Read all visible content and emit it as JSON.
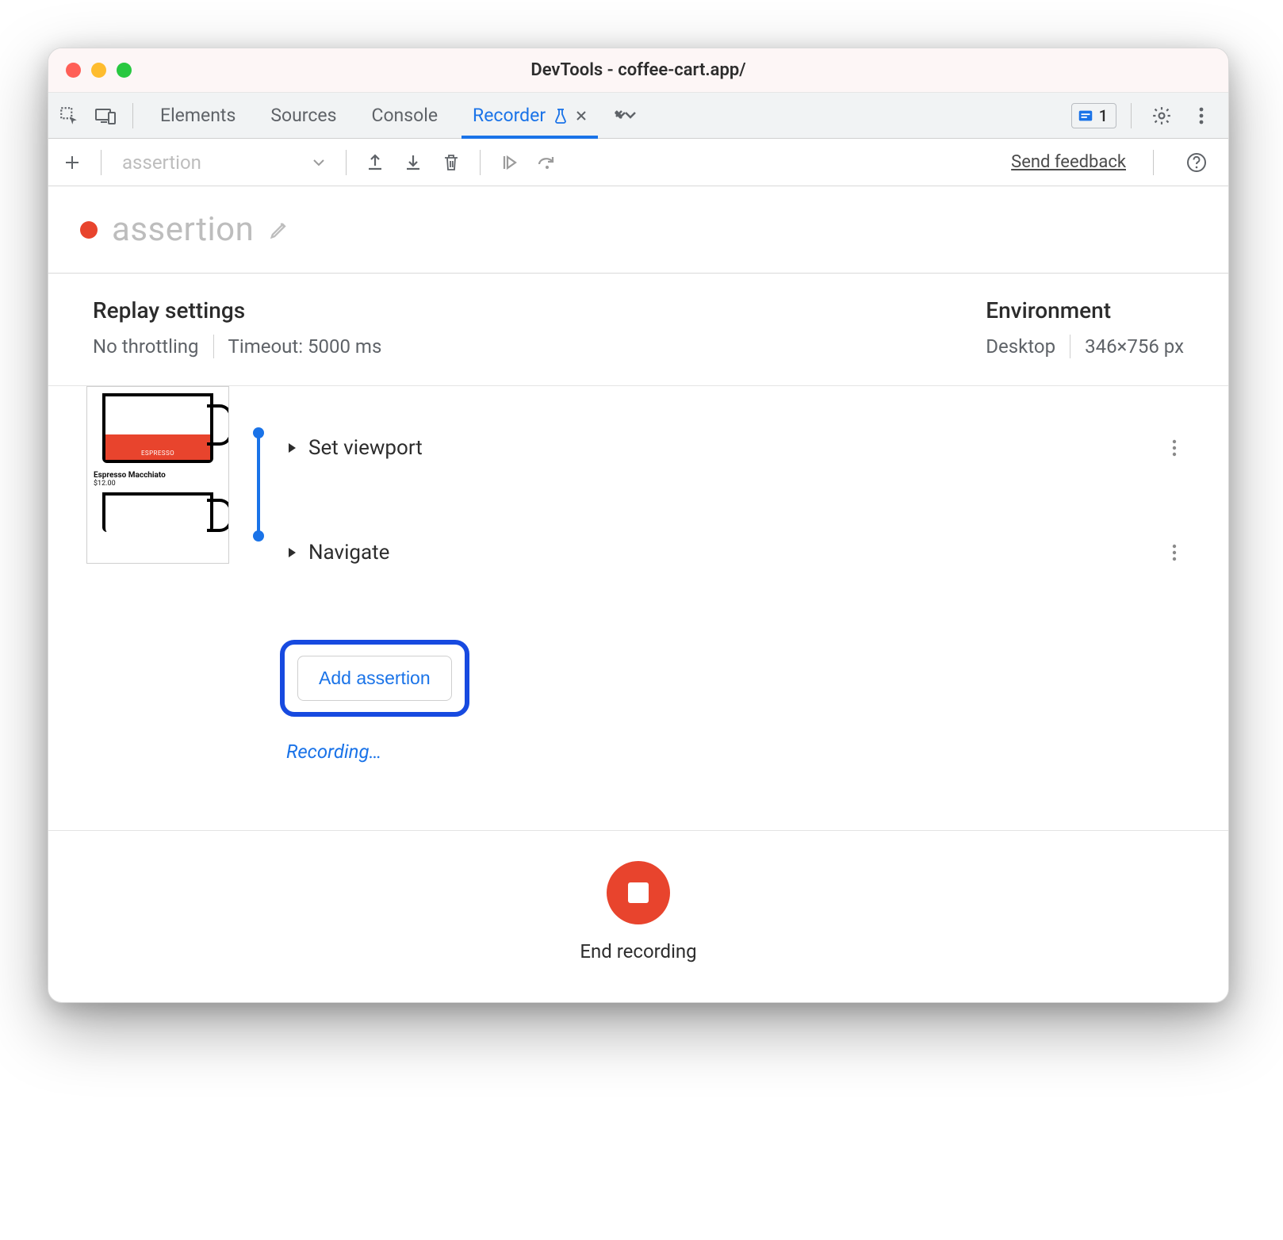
{
  "window": {
    "title": "DevTools - coffee-cart.app/"
  },
  "tabs": {
    "items": [
      {
        "label": "Elements"
      },
      {
        "label": "Sources"
      },
      {
        "label": "Console"
      },
      {
        "label": "Recorder"
      }
    ],
    "issues_count": "1"
  },
  "toolbar": {
    "recording_selector": "assertion",
    "feedback": "Send feedback"
  },
  "recording": {
    "name": "assertion"
  },
  "replay_settings": {
    "heading": "Replay settings",
    "throttling": "No throttling",
    "timeout": "Timeout: 5000 ms"
  },
  "environment": {
    "heading": "Environment",
    "device": "Desktop",
    "viewport": "346×756 px"
  },
  "thumbnail": {
    "item_name": "Espresso Macchiato",
    "item_price": "$12.00",
    "cup_label": "ESPRESSO"
  },
  "steps": [
    {
      "label": "Set viewport"
    },
    {
      "label": "Navigate"
    }
  ],
  "add_assertion_label": "Add assertion",
  "recording_status": "Recording…",
  "end_recording_label": "End recording"
}
